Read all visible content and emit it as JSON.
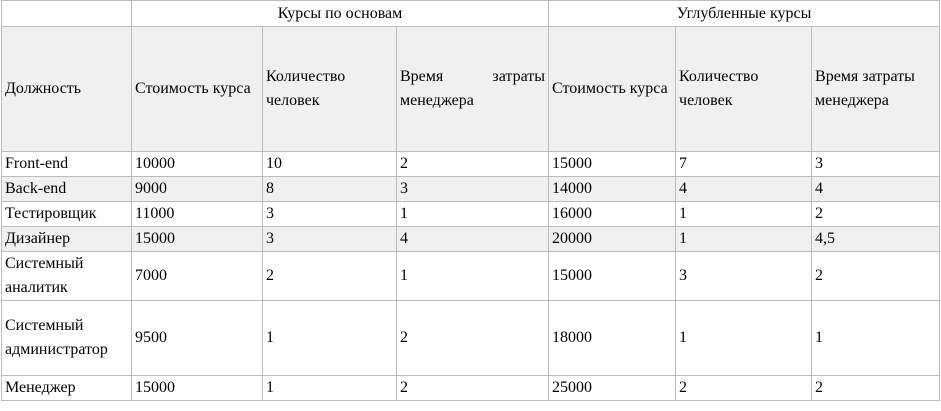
{
  "header": {
    "group_basic": "Курсы по основам",
    "group_advanced": "Углубленные курсы",
    "position": "Должность",
    "basic_cost": "Стоимость курса",
    "basic_count": "Количество человек",
    "basic_time": "Время затраты менеджера",
    "adv_cost": "Стоимость курса",
    "adv_count": "Количество человек",
    "adv_time": "Время затраты менеджера"
  },
  "rows": [
    {
      "position": "Front-end",
      "basic_cost": "10000",
      "basic_count": "10",
      "basic_time": "2",
      "adv_cost": "15000",
      "adv_count": "7",
      "adv_time": "3"
    },
    {
      "position": "Back-end",
      "basic_cost": "9000",
      "basic_count": "8",
      "basic_time": "3",
      "adv_cost": "14000",
      "adv_count": "4",
      "adv_time": "4"
    },
    {
      "position": "Тестировщик",
      "basic_cost": "11000",
      "basic_count": "3",
      "basic_time": "1",
      "adv_cost": "16000",
      "adv_count": "1",
      "adv_time": "2"
    },
    {
      "position": "Дизайнер",
      "basic_cost": "15000",
      "basic_count": "3",
      "basic_time": "4",
      "adv_cost": "20000",
      "adv_count": "1",
      "adv_time": "4,5"
    },
    {
      "position": "Системный аналитик",
      "basic_cost": "7000",
      "basic_count": "2",
      "basic_time": "1",
      "adv_cost": "15000",
      "adv_count": "3",
      "adv_time": "2"
    },
    {
      "position": "Системный администратор",
      "basic_cost": "9500",
      "basic_count": "1",
      "basic_time": "2",
      "adv_cost": "18000",
      "adv_count": "1",
      "adv_time": "1"
    },
    {
      "position": "Менеджер",
      "basic_cost": "15000",
      "basic_count": "1",
      "basic_time": "2",
      "adv_cost": "25000",
      "adv_count": "2",
      "adv_time": "2"
    }
  ]
}
